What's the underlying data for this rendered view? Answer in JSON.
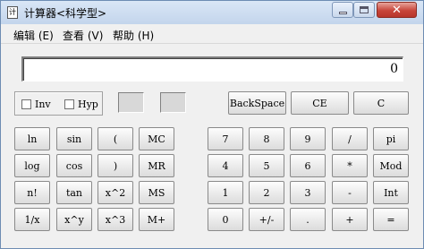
{
  "window": {
    "title": "计算器<科学型>",
    "app_icon_glyph": "计"
  },
  "menu": {
    "items": [
      "编辑 (E)",
      "查看 (V)",
      "帮助 (H)"
    ]
  },
  "display": {
    "value": "0"
  },
  "options": {
    "inv_label": "Inv",
    "hyp_label": "Hyp"
  },
  "top_buttons": {
    "backspace": "BackSpace",
    "ce": "CE",
    "c": "C"
  },
  "buttons": {
    "ln": "ln",
    "sin": "sin",
    "lparen": "(",
    "mc": "MC",
    "log": "log",
    "cos": "cos",
    "rparen": ")",
    "mr": "MR",
    "fact": "n!",
    "tan": "tan",
    "sq": "x^2",
    "ms": "MS",
    "recip": "1/x",
    "pow": "x^y",
    "cube": "x^3",
    "mplus": "M+",
    "d7": "7",
    "d8": "8",
    "d9": "9",
    "div": "/",
    "pi": "pi",
    "d4": "4",
    "d5": "5",
    "d6": "6",
    "mul": "*",
    "mod": "Mod",
    "d1": "1",
    "d2": "2",
    "d3": "3",
    "sub": "-",
    "int": "Int",
    "d0": "0",
    "neg": "+/-",
    "dot": ".",
    "add": "+",
    "eq": "="
  },
  "colors": {
    "close_button": "#c7453a",
    "titlebar": "#c3d5ec"
  }
}
